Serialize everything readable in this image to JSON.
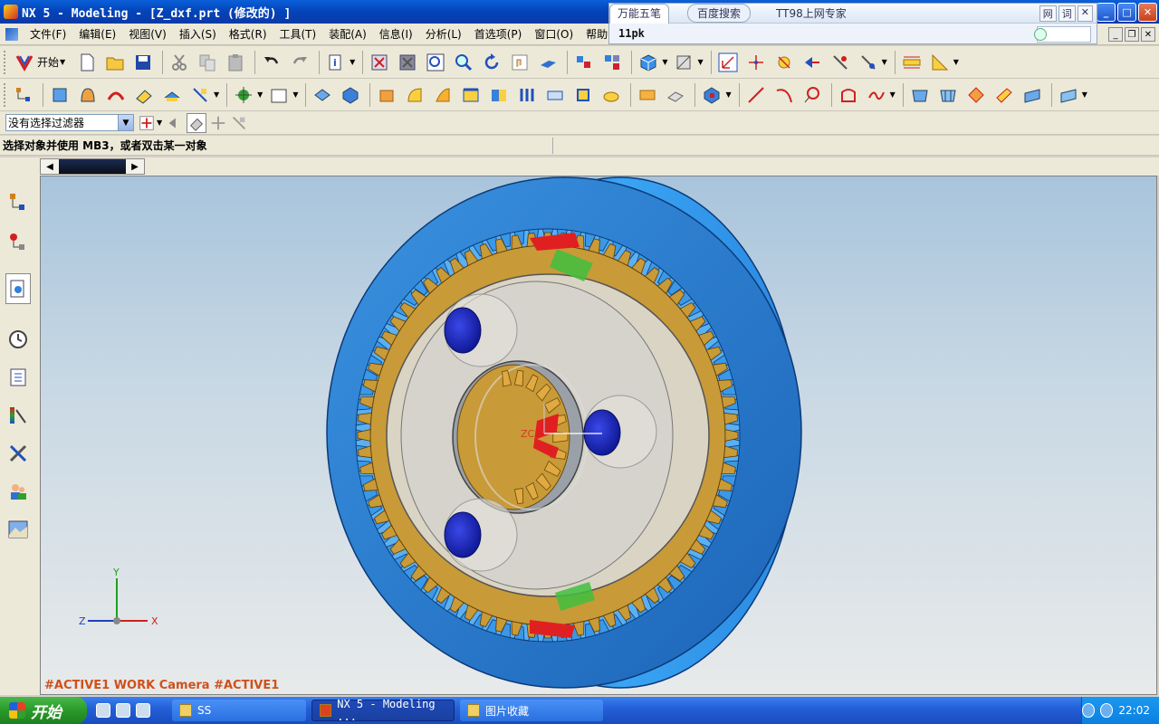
{
  "window": {
    "title": "NX 5 - Modeling - [Z_dxf.prt  (修改的) ]",
    "min": "_",
    "max": "□",
    "close": "✕"
  },
  "ime": {
    "tab_active": "万能五笔",
    "search": "百度搜索",
    "expert": "TT98上网专家",
    "mini": [
      "网",
      "词",
      "✕"
    ],
    "typed": "11pk"
  },
  "menu": {
    "items": [
      "文件(F)",
      "编辑(E)",
      "视图(V)",
      "插入(S)",
      "格式(R)",
      "工具(T)",
      "装配(A)",
      "信息(I)",
      "分析(L)",
      "首选项(P)",
      "窗口(O)",
      "帮助(H)"
    ]
  },
  "toolbar": {
    "start_label": "开始",
    "filter_value": "没有选择过滤器"
  },
  "cue": {
    "text": "选择对象并使用 MB3，或者双击某一对象"
  },
  "viewport": {
    "camera_label": "#ACTIVE1 WORK Camera #ACTIVE1",
    "triad": {
      "x": "X",
      "y": "Y",
      "z": "Z",
      "zc": "ZC"
    }
  },
  "colors": {
    "ring": "#2a86d8",
    "ring_side": "#3aa0f0",
    "gear": "#c89a38",
    "planet_pin": "#1e2ec8",
    "carrier": "#d8d6d0"
  },
  "taskbar": {
    "start": "开始",
    "tasks": [
      "SS",
      "NX 5 - Modeling ...",
      "图片收藏"
    ],
    "clock": "22:02"
  }
}
